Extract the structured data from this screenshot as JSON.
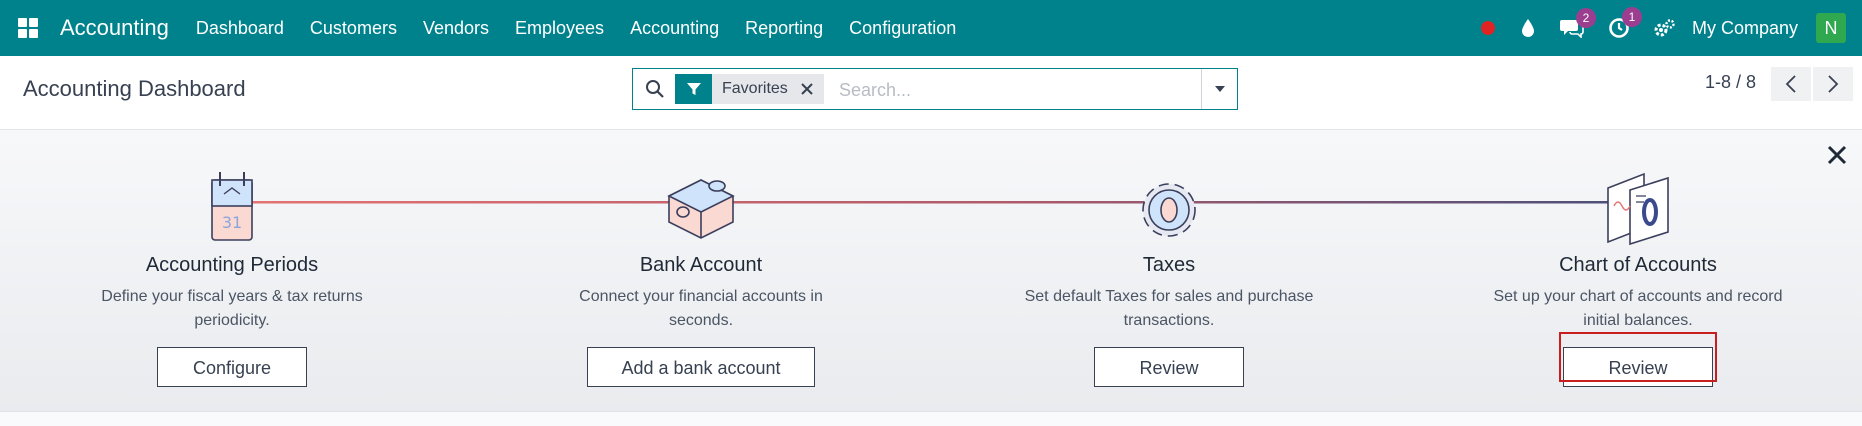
{
  "navbar": {
    "app_name": "Accounting",
    "menu": [
      "Dashboard",
      "Customers",
      "Vendors",
      "Employees",
      "Accounting",
      "Reporting",
      "Configuration"
    ],
    "messages_count": "2",
    "activities_count": "1",
    "company": "My Company",
    "avatar_letter": "N",
    "accent_color": "#00828c"
  },
  "control_panel": {
    "title": "Accounting Dashboard",
    "facet_label": "Favorites",
    "search_placeholder": "Search...",
    "pager": "1-8 / 8"
  },
  "onboarding": {
    "steps": [
      {
        "title": "Accounting Periods",
        "desc_line1": "Define your fiscal years & tax returns",
        "desc_line2": "periodicity.",
        "button": "Configure",
        "icon": "calendar-icon"
      },
      {
        "title": "Bank Account",
        "desc_line1": "Connect your financial accounts in",
        "desc_line2": "seconds.",
        "button": "Add a bank account",
        "icon": "puzzle-icon"
      },
      {
        "title": "Taxes",
        "desc_line1": "Set default Taxes for sales and purchase",
        "desc_line2": "transactions.",
        "button": "Review",
        "icon": "gear-icon"
      },
      {
        "title": "Chart of Accounts",
        "desc_line1": "Set up your chart of accounts and record",
        "desc_line2": "initial balances.",
        "button": "Review",
        "icon": "ledger-icon"
      }
    ]
  }
}
